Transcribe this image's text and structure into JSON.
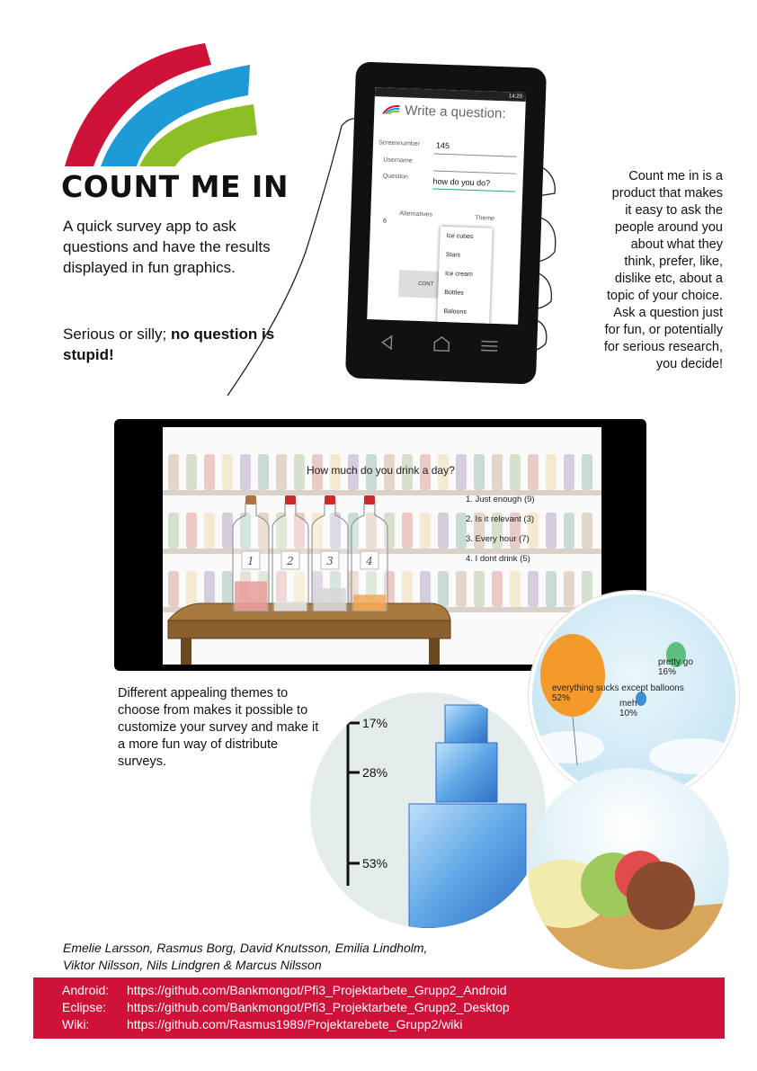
{
  "header": {
    "title": "COUNT ME IN",
    "intro": "A quick survey app to ask questions and have the results displayed in fun graphics.",
    "intro2_plain": "Serious or silly; ",
    "intro2_bold": "no question is stupid!"
  },
  "colors": {
    "red": "#cf1238",
    "blue": "#1e9ad6",
    "green": "#8cbf26"
  },
  "product_text": [
    "Count me in is a",
    "product that makes",
    "it easy to ask the",
    "people around you",
    "about what they",
    "think, prefer, like,",
    "dislike etc, about a",
    "topic of your choice.",
    "Ask a question just",
    "for fun, or potentially",
    "for serious research,",
    "you decide!"
  ],
  "phone": {
    "status_time": "14:20",
    "heading": "Write a question:",
    "screen_label": "Screennumber",
    "screen_value": "145",
    "username_label": "Username",
    "question_label": "Question",
    "question_value": "how do you do?",
    "alternatives_label": "Alternatives",
    "alternatives_value": "6",
    "theme_label": "Theme",
    "continue_label": "CONT",
    "theme_options": [
      "Ice cubes",
      "Stars",
      "Ice cream",
      "Bottles",
      "Baloons"
    ]
  },
  "bottles": {
    "question": "How much do you drink a day?",
    "answers": [
      "1. Just enough (9)",
      "2. Is it relevant (3)",
      "3. Every hour (7)",
      "4. I dont drink  (5)"
    ],
    "labels": [
      "1",
      "2",
      "3",
      "4"
    ],
    "levels": [
      0.36,
      0.12,
      0.28,
      0.2
    ]
  },
  "balloons": [
    {
      "label": "everything sucks except balloons",
      "pct": "52%"
    },
    {
      "label": "pretty go",
      "pct": "16%"
    },
    {
      "label": "meh",
      "pct": "10%"
    }
  ],
  "ice": {
    "percents": [
      "17%",
      "28%",
      "53%"
    ]
  },
  "themes_text": "Different appealing themes to choose from makes it possible to customize your survey and make it a more fun way of distribute surveys.",
  "authors": [
    "Emelie Larsson, Rasmus Borg, David Knutsson, Emilia Lindholm,",
    "Viktor Nilsson, Nils Lindgren & Marcus Nilsson"
  ],
  "links": [
    {
      "label": "Android:",
      "url": "https://github.com/Bankmongot/Pfi3_Projektarbete_Grupp2_Android"
    },
    {
      "label": "Eclipse:",
      "url": "https://github.com/Bankmongot/Pfi3_Projektarbete_Grupp2_Desktop"
    },
    {
      "label": "Wiki:",
      "url": "https://github.com/Rasmus1989/Projektarebete_Grupp2/wiki"
    }
  ]
}
